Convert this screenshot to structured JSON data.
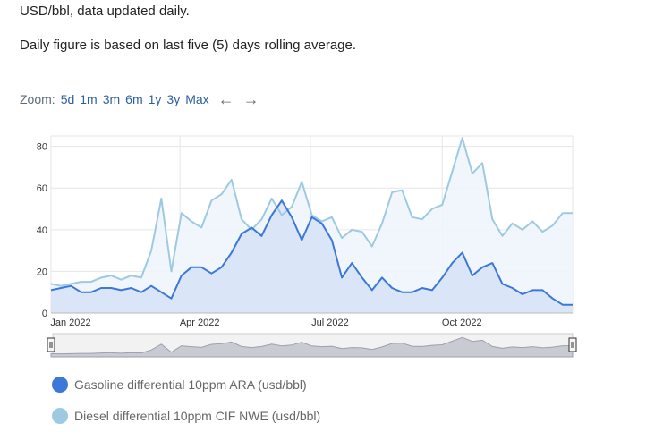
{
  "intro": {
    "line1": "USD/bbl, data updated daily.",
    "line2": "Daily figure is based on last five (5) days rolling average."
  },
  "zoom": {
    "label": "Zoom:",
    "options": [
      "5d",
      "1m",
      "3m",
      "6m",
      "1y",
      "3y",
      "Max"
    ],
    "prev_icon": "arrow-left-icon",
    "next_icon": "arrow-right-icon"
  },
  "colors": {
    "gasoline": "#3c78d8",
    "diesel": "#9ecae1",
    "gasoline_fill": "#d6e2f7",
    "diesel_fill": "#eef5fb",
    "grid": "#e6e6e6",
    "navigator_fill": "#c9cbd3"
  },
  "chart_data": {
    "type": "area",
    "x_axis_type": "date",
    "x_range": [
      "2022-01-01",
      "2022-12-31"
    ],
    "ylim": [
      0,
      85
    ],
    "yticks": [
      0,
      20,
      40,
      60,
      80
    ],
    "xticks": [
      {
        "date": "2022-01-01",
        "label": "Jan 2022"
      },
      {
        "date": "2022-04-01",
        "label": "Apr 2022"
      },
      {
        "date": "2022-07-01",
        "label": "Jul 2022"
      },
      {
        "date": "2022-10-01",
        "label": "Oct 2022"
      }
    ],
    "grid": true,
    "legend_position": "bottom-left",
    "series": [
      {
        "name": "Gasoline differential 10ppm ARA (usd/bbl)",
        "color": "#3c78d8",
        "points": [
          [
            "2022-01-01",
            11
          ],
          [
            "2022-01-08",
            12
          ],
          [
            "2022-01-15",
            13
          ],
          [
            "2022-01-22",
            10
          ],
          [
            "2022-01-29",
            10
          ],
          [
            "2022-02-05",
            12
          ],
          [
            "2022-02-12",
            12
          ],
          [
            "2022-02-19",
            11
          ],
          [
            "2022-02-26",
            12
          ],
          [
            "2022-03-05",
            10
          ],
          [
            "2022-03-12",
            13
          ],
          [
            "2022-03-19",
            10
          ],
          [
            "2022-03-26",
            7
          ],
          [
            "2022-04-02",
            18
          ],
          [
            "2022-04-09",
            22
          ],
          [
            "2022-04-16",
            22
          ],
          [
            "2022-04-23",
            19
          ],
          [
            "2022-04-30",
            22
          ],
          [
            "2022-05-07",
            29
          ],
          [
            "2022-05-14",
            38
          ],
          [
            "2022-05-21",
            41
          ],
          [
            "2022-05-28",
            37
          ],
          [
            "2022-06-04",
            47
          ],
          [
            "2022-06-11",
            54
          ],
          [
            "2022-06-18",
            46
          ],
          [
            "2022-06-25",
            35
          ],
          [
            "2022-07-02",
            46
          ],
          [
            "2022-07-09",
            43
          ],
          [
            "2022-07-16",
            35
          ],
          [
            "2022-07-23",
            17
          ],
          [
            "2022-07-30",
            24
          ],
          [
            "2022-08-06",
            17
          ],
          [
            "2022-08-13",
            11
          ],
          [
            "2022-08-20",
            17
          ],
          [
            "2022-08-27",
            12
          ],
          [
            "2022-09-03",
            10
          ],
          [
            "2022-09-10",
            10
          ],
          [
            "2022-09-17",
            12
          ],
          [
            "2022-09-24",
            11
          ],
          [
            "2022-10-01",
            17
          ],
          [
            "2022-10-08",
            24
          ],
          [
            "2022-10-15",
            29
          ],
          [
            "2022-10-22",
            18
          ],
          [
            "2022-10-29",
            22
          ],
          [
            "2022-11-05",
            24
          ],
          [
            "2022-11-12",
            14
          ],
          [
            "2022-11-19",
            12
          ],
          [
            "2022-11-26",
            9
          ],
          [
            "2022-12-03",
            11
          ],
          [
            "2022-12-10",
            11
          ],
          [
            "2022-12-17",
            7
          ],
          [
            "2022-12-24",
            4
          ],
          [
            "2022-12-31",
            4
          ]
        ]
      },
      {
        "name": "Diesel differential 10ppm CIF NWE (usd/bbl)",
        "color": "#9ecae1",
        "points": [
          [
            "2022-01-01",
            14
          ],
          [
            "2022-01-08",
            13
          ],
          [
            "2022-01-15",
            14
          ],
          [
            "2022-01-22",
            15
          ],
          [
            "2022-01-29",
            15
          ],
          [
            "2022-02-05",
            17
          ],
          [
            "2022-02-12",
            18
          ],
          [
            "2022-02-19",
            16
          ],
          [
            "2022-02-26",
            18
          ],
          [
            "2022-03-05",
            17
          ],
          [
            "2022-03-12",
            30
          ],
          [
            "2022-03-19",
            55
          ],
          [
            "2022-03-26",
            20
          ],
          [
            "2022-04-02",
            48
          ],
          [
            "2022-04-09",
            44
          ],
          [
            "2022-04-16",
            41
          ],
          [
            "2022-04-23",
            54
          ],
          [
            "2022-04-30",
            57
          ],
          [
            "2022-05-07",
            64
          ],
          [
            "2022-05-14",
            45
          ],
          [
            "2022-05-21",
            40
          ],
          [
            "2022-05-28",
            45
          ],
          [
            "2022-06-04",
            55
          ],
          [
            "2022-06-11",
            47
          ],
          [
            "2022-06-18",
            51
          ],
          [
            "2022-06-25",
            63
          ],
          [
            "2022-07-02",
            47
          ],
          [
            "2022-07-09",
            44
          ],
          [
            "2022-07-16",
            46
          ],
          [
            "2022-07-23",
            36
          ],
          [
            "2022-07-30",
            40
          ],
          [
            "2022-08-06",
            39
          ],
          [
            "2022-08-13",
            32
          ],
          [
            "2022-08-20",
            43
          ],
          [
            "2022-08-27",
            58
          ],
          [
            "2022-09-03",
            59
          ],
          [
            "2022-09-10",
            46
          ],
          [
            "2022-09-17",
            45
          ],
          [
            "2022-09-24",
            50
          ],
          [
            "2022-10-01",
            52
          ],
          [
            "2022-10-08",
            68
          ],
          [
            "2022-10-15",
            84
          ],
          [
            "2022-10-22",
            67
          ],
          [
            "2022-10-29",
            72
          ],
          [
            "2022-11-05",
            45
          ],
          [
            "2022-11-12",
            37
          ],
          [
            "2022-11-19",
            43
          ],
          [
            "2022-11-26",
            40
          ],
          [
            "2022-12-03",
            44
          ],
          [
            "2022-12-10",
            39
          ],
          [
            "2022-12-17",
            42
          ],
          [
            "2022-12-24",
            48
          ],
          [
            "2022-12-31",
            48
          ]
        ]
      }
    ],
    "navigator": {
      "selected_from": "2022-01-01",
      "selected_to": "2022-12-31"
    }
  }
}
